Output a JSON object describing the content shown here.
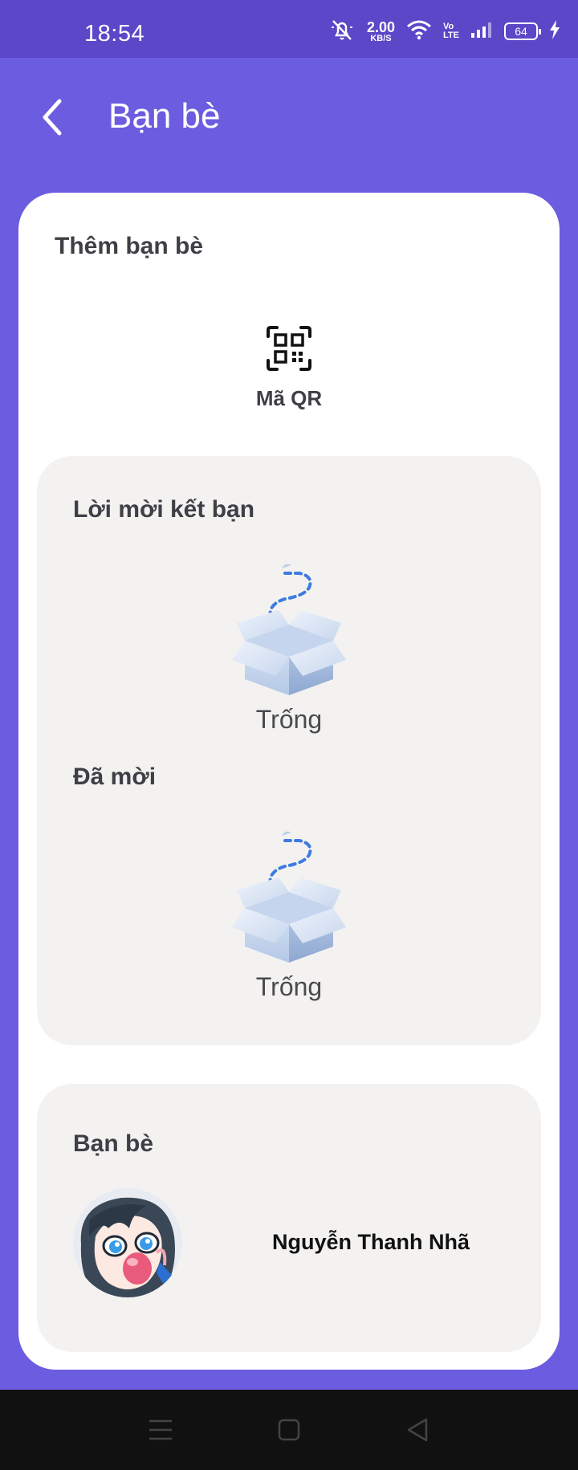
{
  "status_bar": {
    "time": "18:54",
    "speed_value": "2.00",
    "speed_unit": "KB/S",
    "volte_top": "Vo",
    "volte_bottom": "LTE",
    "battery": "64"
  },
  "header": {
    "title": "Bạn bè"
  },
  "add_friends": {
    "title": "Thêm bạn bè",
    "qr_label": "Mã QR"
  },
  "friend_requests": {
    "title": "Lời mời kết bạn",
    "empty_text": "Trống"
  },
  "invited": {
    "title": "Đã mời",
    "empty_text": "Trống"
  },
  "friends": {
    "title": "Bạn bè",
    "items": [
      {
        "name": "Nguyễn Thanh Nhã"
      }
    ]
  },
  "colors": {
    "accent": "#6c5ce0",
    "status_bar": "#5b47c7",
    "panel": "#f3f2f1"
  }
}
